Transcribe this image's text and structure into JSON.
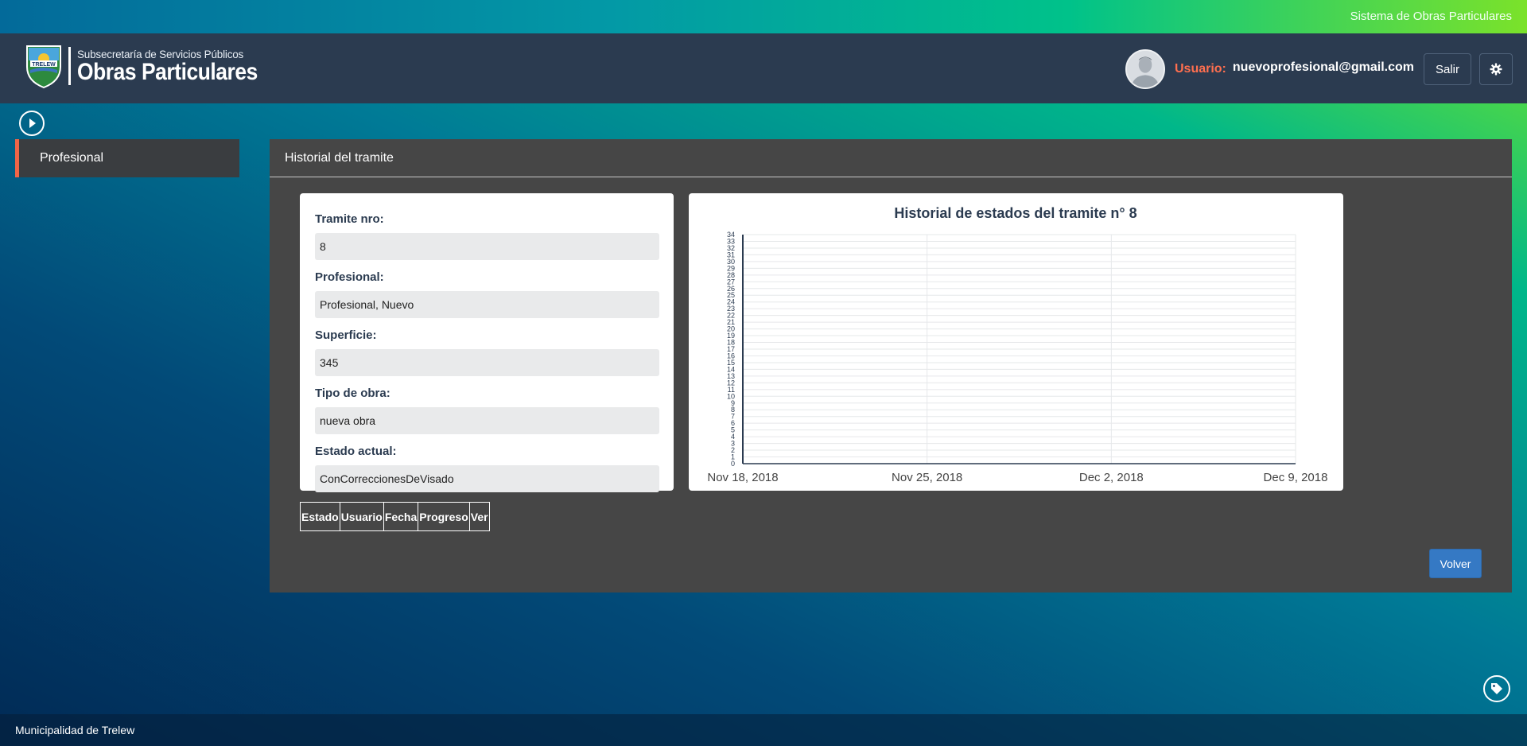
{
  "top_bar": {
    "system_name": "Sistema de Obras Particulares"
  },
  "header": {
    "logo_subtitle": "Subsecretaría de Servicios Públicos",
    "logo_title": "Obras Particulares",
    "logo_badge": "TRELEW",
    "user_label": "Usuario:",
    "user_email": "nuevoprofesional@gmail.com",
    "logout_label": "Salir",
    "settings_icon": "gear-icon"
  },
  "sidebar": {
    "items": [
      {
        "label": "Profesional"
      }
    ]
  },
  "panel": {
    "title": "Historial del tramite",
    "fields": [
      {
        "label": "Tramite nro:",
        "value": "8"
      },
      {
        "label": "Profesional:",
        "value": "Profesional, Nuevo"
      },
      {
        "label": "Superficie:",
        "value": "345"
      },
      {
        "label": "Tipo de obra:",
        "value": "nueva obra"
      },
      {
        "label": "Estado actual:",
        "value": "ConCorreccionesDeVisado"
      }
    ],
    "table_headers": [
      "Estado",
      "Usuario",
      "Fecha",
      "Progreso",
      "Ver"
    ],
    "back_label": "Volver"
  },
  "footer": {
    "text": "Municipalidad de Trelew"
  },
  "colors": {
    "accent_red": "#f16547",
    "navbar": "#2b3b50",
    "panel": "#464646",
    "primary_button": "#3579c4"
  },
  "chart_data": {
    "type": "line",
    "title": "Historial de estados del tramite n° 8",
    "x_ticks": [
      "Nov 18, 2018",
      "Nov 25, 2018",
      "Dec 2, 2018",
      "Dec 9, 2018"
    ],
    "ylim": [
      0,
      34
    ],
    "y_ticks": [
      0,
      1,
      2,
      3,
      4,
      5,
      6,
      7,
      8,
      9,
      10,
      11,
      12,
      13,
      14,
      15,
      16,
      17,
      18,
      19,
      20,
      21,
      22,
      23,
      24,
      25,
      26,
      27,
      28,
      29,
      30,
      31,
      32,
      33,
      34
    ],
    "series": [],
    "grid": true
  }
}
